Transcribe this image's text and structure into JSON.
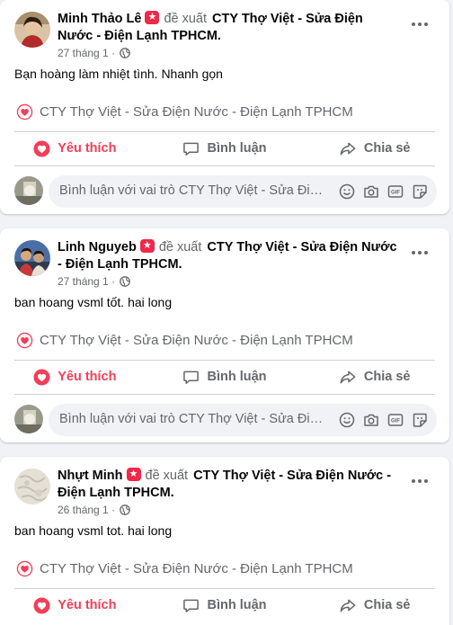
{
  "posts": [
    {
      "author": "Minh Thảo Lê",
      "verb": "đề xuất",
      "page": "CTY Thợ Việt - Sửa Điện Nước - Điện Lạnh TPHCM.",
      "date": "27 tháng 1",
      "separator": "·",
      "review": "Bạn hoàng làm nhiệt tình. Nhanh gọn",
      "recommended_page": "CTY Thợ Việt - Sửa Điện Nước - Điện Lạnh TPHCM",
      "like_label": "Yêu thích",
      "comment_label": "Bình luận",
      "share_label": "Chia sẻ",
      "comment_placeholder": "Bình luận với vai trò CTY Thợ Việt - Sửa Điện Nước - Điện Lạnh TPHCM"
    },
    {
      "author": "Linh Nguyeb",
      "verb": "đề xuất",
      "page": "CTY Thợ Việt - Sửa Điện Nước - Điện Lạnh TPHCM.",
      "date": "27 tháng 1",
      "separator": "·",
      "review": "ban hoang vsml tốt.  hai long",
      "recommended_page": "CTY Thợ Việt - Sửa Điện Nước - Điện Lạnh TPHCM",
      "like_label": "Yêu thích",
      "comment_label": "Bình luận",
      "share_label": "Chia sẻ",
      "comment_placeholder": "Bình luận với vai trò CTY Thợ Việt - Sửa Điện Nước - Điện Lạnh TPHCM"
    },
    {
      "author": "Nhựt Minh",
      "verb": "đề xuất",
      "page": "CTY Thợ Việt - Sửa Điện Nước - Điện Lạnh TPHCM.",
      "date": "26 tháng 1",
      "separator": "·",
      "review": "ban hoang vsml tot. hai long",
      "recommended_page": "CTY Thợ Việt - Sửa Điện Nước - Điện Lạnh TPHCM",
      "like_label": "Yêu thích",
      "comment_label": "Bình luận",
      "share_label": "Chia sẻ"
    }
  ],
  "colors": {
    "accent": "#f33e58",
    "muted": "#65676b",
    "card_bg": "#ffffff",
    "page_bg": "#f0f2f5"
  },
  "icons": {
    "globe": "globe-icon",
    "more": "more-options-icon",
    "heart": "heart-icon",
    "comment": "comment-icon",
    "share": "share-icon"
  }
}
